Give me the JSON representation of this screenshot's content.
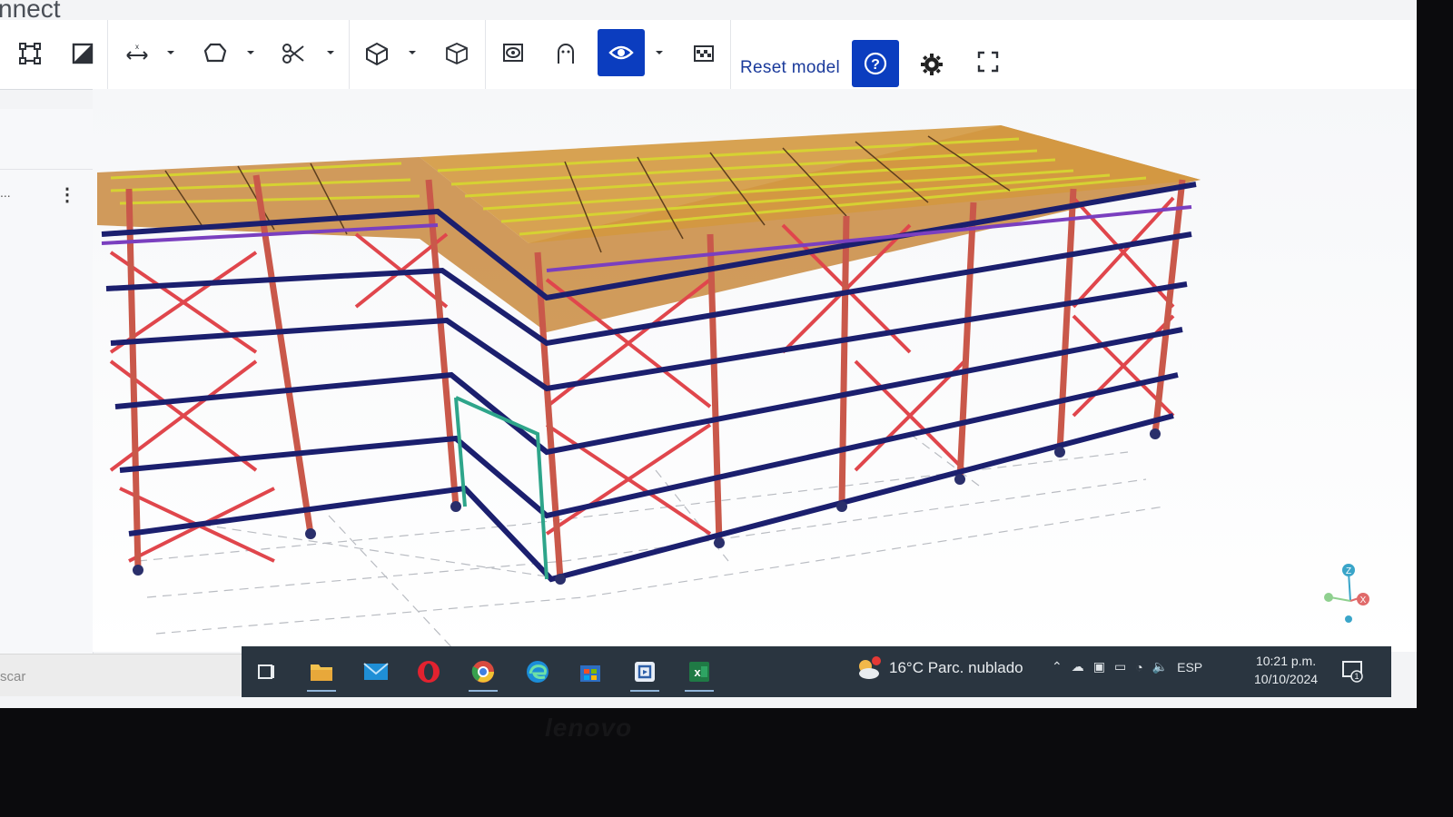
{
  "app": {
    "title_fragment": "nnect"
  },
  "toolbar": {
    "reset_model_label": "Reset model",
    "tools": [
      {
        "name": "select-box-icon"
      },
      {
        "name": "section-plane-icon"
      },
      {
        "name": "measure-icon"
      },
      {
        "name": "shape-icon"
      },
      {
        "name": "cut-icon"
      },
      {
        "name": "box-view-icon"
      },
      {
        "name": "isometric-cube-icon"
      },
      {
        "name": "render-mode-icon"
      },
      {
        "name": "ghost-icon"
      },
      {
        "name": "visibility-eye-icon",
        "active": true
      },
      {
        "name": "transparency-icon"
      },
      {
        "name": "help-icon",
        "active": true
      },
      {
        "name": "settings-gear-icon"
      },
      {
        "name": "fullscreen-icon"
      }
    ]
  },
  "left_panel": {
    "item_label": "...",
    "menu_icon": "kebab-menu-icon"
  },
  "search": {
    "placeholder": "scar"
  },
  "taskbar": {
    "apps": [
      "task-view-icon",
      "file-explorer-icon",
      "mail-icon",
      "opera-browser-icon",
      "chrome-browser-icon",
      "edge-browser-icon",
      "microsoft-store-icon",
      "teams-icon",
      "excel-icon"
    ],
    "weather": {
      "temp": "16°C",
      "condition": "Parc. nublado",
      "badge": "1"
    },
    "tray_lang": "ESP",
    "clock_time": "10:21 p.m.",
    "clock_date": "10/10/2024",
    "notification_count": "1"
  },
  "viewer": {
    "axis_labels": {
      "z": "Z",
      "x": "X"
    }
  },
  "colors": {
    "accent_blue": "#0b3dbf",
    "beam_orange": "#d8893a",
    "beam_yellow": "#d6d232",
    "brace_red": "#e0464c",
    "girt_navy": "#1b1f6e",
    "purlin_purple": "#7a3fbf",
    "taskbar_bg": "#2a3540"
  },
  "bezel": {
    "brand": "lenovo"
  }
}
